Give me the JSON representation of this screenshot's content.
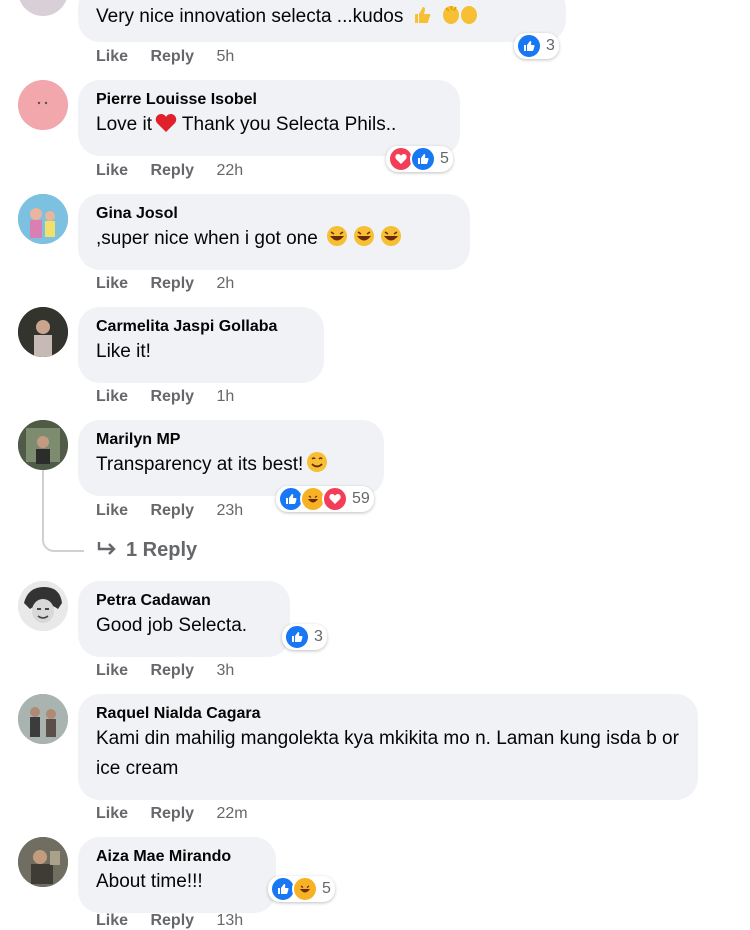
{
  "actions": {
    "like": "Like",
    "reply": "Reply"
  },
  "comments": [
    {
      "author": "",
      "text": "Very nice innovation selecta ...kudos",
      "time": "5h",
      "reaction_count": "3",
      "reactions": [
        "like"
      ]
    },
    {
      "author": "Pierre Louisse Isobel",
      "text_before": "Love it",
      "text_after": " Thank you Selecta Phils..",
      "time": "22h",
      "reaction_count": "5",
      "reactions": [
        "love",
        "like"
      ]
    },
    {
      "author": "Gina Josol",
      "text": ",super nice when i got one",
      "time": "2h"
    },
    {
      "author": "Carmelita Jaspi Gollaba",
      "text": "Like it!",
      "time": "1h"
    },
    {
      "author": "Marilyn MP",
      "text": "Transparency at its best!",
      "time": "23h",
      "reaction_count": "59",
      "reactions": [
        "like",
        "haha",
        "love"
      ],
      "replies_label": "1 Reply"
    },
    {
      "author": "Petra Cadawan",
      "text": "Good job Selecta.",
      "time": "3h",
      "reaction_count": "3",
      "reactions": [
        "like"
      ]
    },
    {
      "author": "Raquel Nialda Cagara",
      "text": "Kami din mahilig mangolekta kya mkikita mo n. Laman kung isda b or ice cream",
      "time": "22m"
    },
    {
      "author": "Aiza Mae Mirando",
      "text": "About time!!!",
      "time": "13h",
      "reaction_count": "5",
      "reactions": [
        "like",
        "haha"
      ]
    }
  ],
  "colors": {
    "bubble": "#f0f2f5",
    "meta_text": "#65676b",
    "like_blue": "#1877f2",
    "love_red": "#f33e58",
    "haha_yellow": "#f7b125"
  }
}
